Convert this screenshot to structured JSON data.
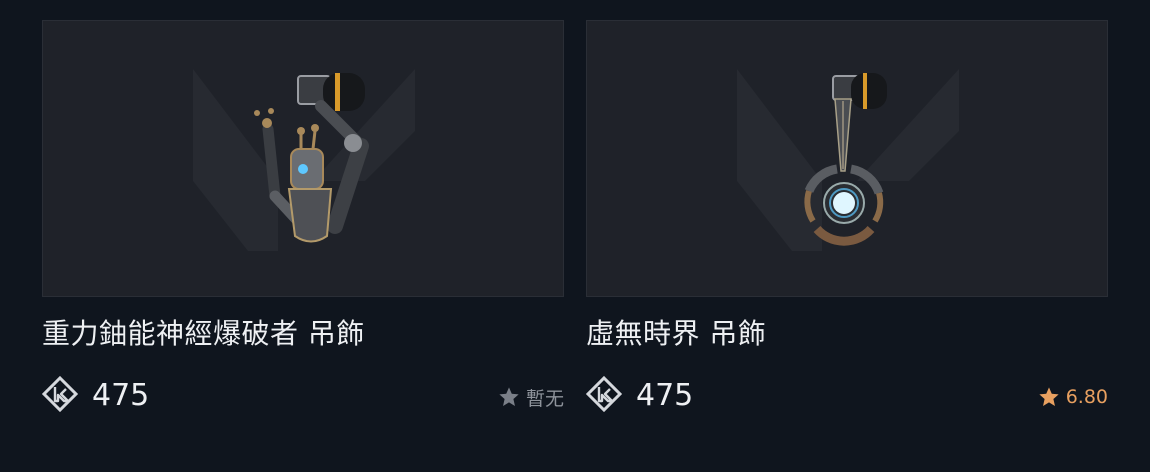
{
  "colors": {
    "background": "#0f151e",
    "card_bg": "#1f2229",
    "title_text": "#eef0f3",
    "rating_none": "#8e939b",
    "rating_scored": "#e8a060"
  },
  "items": [
    {
      "title": "重力鈾能神經爆破者 吊飾",
      "price": "475",
      "rating_text": "暫无",
      "rating_icon": "star-icon",
      "price_icon": "valorant-points-icon",
      "image": "robotic-arm-charm"
    },
    {
      "title": "虛無時界 吊飾",
      "price": "475",
      "rating_text": "6.80",
      "rating_icon": "star-icon",
      "price_icon": "valorant-points-icon",
      "image": "orb-pendant-charm"
    }
  ]
}
